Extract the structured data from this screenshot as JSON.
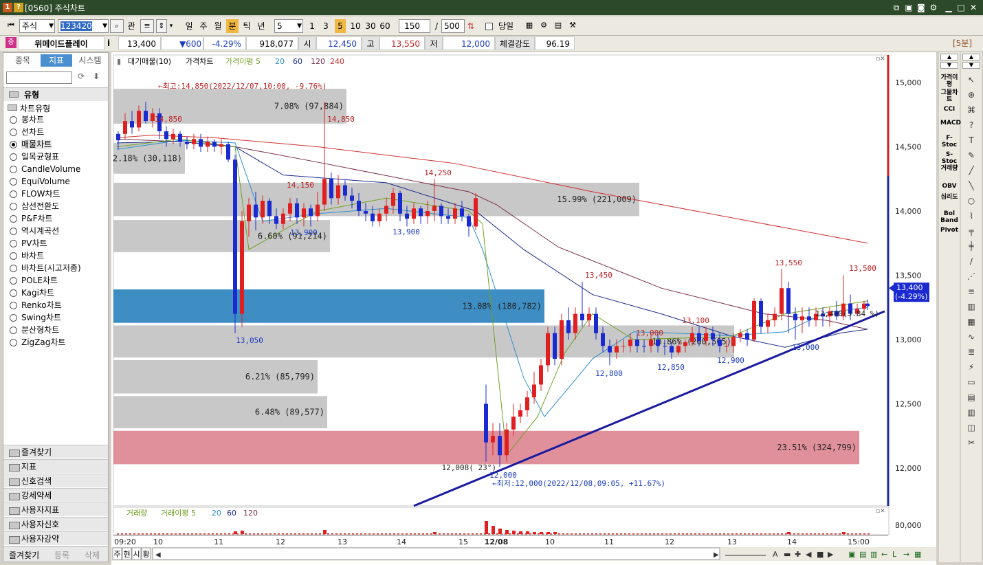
{
  "title": "[0560] 주식차트",
  "toolbar": {
    "market": "주식",
    "code": "123420",
    "period_buttons": [
      "일",
      "주",
      "월",
      "분",
      "틱",
      "년"
    ],
    "active_period": "분",
    "interval": "5",
    "minute_buttons": [
      "1",
      "3",
      "5",
      "10",
      "30",
      "60"
    ],
    "count": "150",
    "max_count": "500",
    "today_label": "당일",
    "sep": "/",
    "kwan": "관"
  },
  "quote": {
    "badge": "증",
    "name": "위메이드플레이",
    "i": "i",
    "price": "13,400",
    "change": "▼600",
    "change_pct": "-4.29%",
    "volume": "918,077",
    "open_label": "시",
    "open": "12,450",
    "high_label": "고",
    "high": "13,550",
    "low_label": "저",
    "low": "12,000",
    "strength_label": "체결강도",
    "strength": "96.19",
    "period_tag": "[5분]"
  },
  "left": {
    "tabs": [
      "종목",
      "지표",
      "시스템"
    ],
    "active_tab": "지표",
    "section": "유형",
    "group": "차트유형",
    "chart_types": [
      "봉차트",
      "선차트",
      "매물차트",
      "일목균형표",
      "CandleVolume",
      "EquiVolume",
      "FLOW차트",
      "삼선전환도",
      "P&F차트",
      "역시계곡선",
      "PV차트",
      "바차트",
      "바차트(시고저종)",
      "POLE차트",
      "Kagi차트",
      "Renko차트",
      "Swing차트",
      "분산형차트",
      "ZigZag차트"
    ],
    "selected": "매물차트",
    "folders": [
      "즐겨찾기",
      "지표",
      "신호검색",
      "강세약세",
      "사용자지표",
      "사용자신호",
      "사용자강약"
    ],
    "bottom_tabs": [
      "즐겨찾기",
      "등록",
      "삭제"
    ]
  },
  "chart": {
    "legend": [
      "대기매물(10)",
      "가격차트",
      "가격이평 5",
      "20",
      "60",
      "120",
      "240"
    ],
    "vol_legend": [
      "거래량",
      "거래이평 5",
      "20",
      "60",
      "120"
    ],
    "y_labels": [
      "15,000",
      "14,500",
      "14,000",
      "13,500",
      "13,000",
      "12,500",
      "12,000"
    ],
    "vol_y_label": "80,000",
    "x_labels": [
      "09:20",
      "10",
      "11",
      "12",
      "13",
      "14",
      "15",
      "12/08",
      "10",
      "11",
      "12",
      "13",
      "14",
      "15:00"
    ],
    "current_price": "13,400",
    "current_pct": "(-4.29%)",
    "high_note": "←최고:14,850(2022/12/07,10:00, -9.76%)",
    "low_note": "←최저:12,000(2022/12/08,09:05, +11.67%)",
    "volume_bands": [
      {
        "label": "7.08% (97,884)",
        "pct": 7.08
      },
      {
        "label": "2.18% (30,118)",
        "pct": 2.18
      },
      {
        "label": "15.99% (221,009)",
        "pct": 15.99
      },
      {
        "label": "6.60% (91,214)",
        "pct": 6.6
      },
      {
        "label": "13.08% (180,782)",
        "pct": 13.08
      },
      {
        "label": "18.86% (260,565)",
        "pct": 18.86
      },
      {
        "label": "6.21% (85,799)",
        "pct": 6.21
      },
      {
        "label": "6.48% (89,577)",
        "pct": 6.48
      },
      {
        "label": "23.51% (324,799)",
        "pct": 23.51
      }
    ],
    "price_labels": [
      "14,850",
      "14,850",
      "14,150",
      "14,250",
      "13,900",
      "13,900",
      "13,050",
      "13,450",
      "13,000",
      "13,100",
      "12,800",
      "12,850",
      "12,900",
      "13,550",
      "13,500",
      "13,000",
      "12,000",
      "12,008( 23°)",
      "13,400(3.84 %)"
    ],
    "bottom_btns": [
      "주",
      "현",
      "시",
      "황"
    ]
  },
  "indicators": [
    "가격이평",
    "그물차트",
    "CCI",
    "MACD",
    "F-Stoc",
    "S-Stoc",
    "거래량",
    "OBV",
    "심리도",
    "Bol Band",
    "Pivot"
  ]
}
